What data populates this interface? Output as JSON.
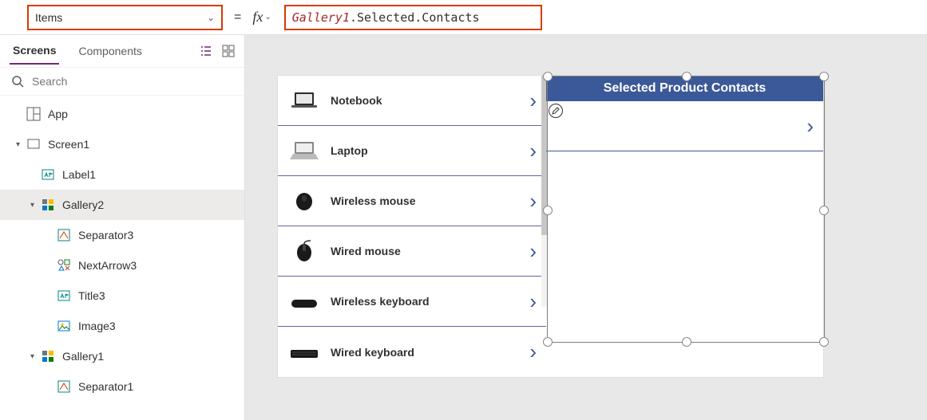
{
  "property_selector": {
    "value": "Items"
  },
  "formula": {
    "gallery_ref": "Gallery1",
    "rest": ".Selected.Contacts"
  },
  "tabs": {
    "screens": "Screens",
    "components": "Components"
  },
  "search": {
    "placeholder": "Search"
  },
  "tree": {
    "app": "App",
    "screen1": "Screen1",
    "label1": "Label1",
    "gallery2": "Gallery2",
    "separator3": "Separator3",
    "nextarrow3": "NextArrow3",
    "title3": "Title3",
    "image3": "Image3",
    "gallery1": "Gallery1",
    "separator1": "Separator1"
  },
  "gallery1_items": [
    {
      "title": "Notebook"
    },
    {
      "title": "Laptop"
    },
    {
      "title": "Wireless mouse"
    },
    {
      "title": "Wired mouse"
    },
    {
      "title": "Wireless keyboard"
    },
    {
      "title": "Wired keyboard"
    }
  ],
  "gallery2_header": "Selected Product Contacts"
}
